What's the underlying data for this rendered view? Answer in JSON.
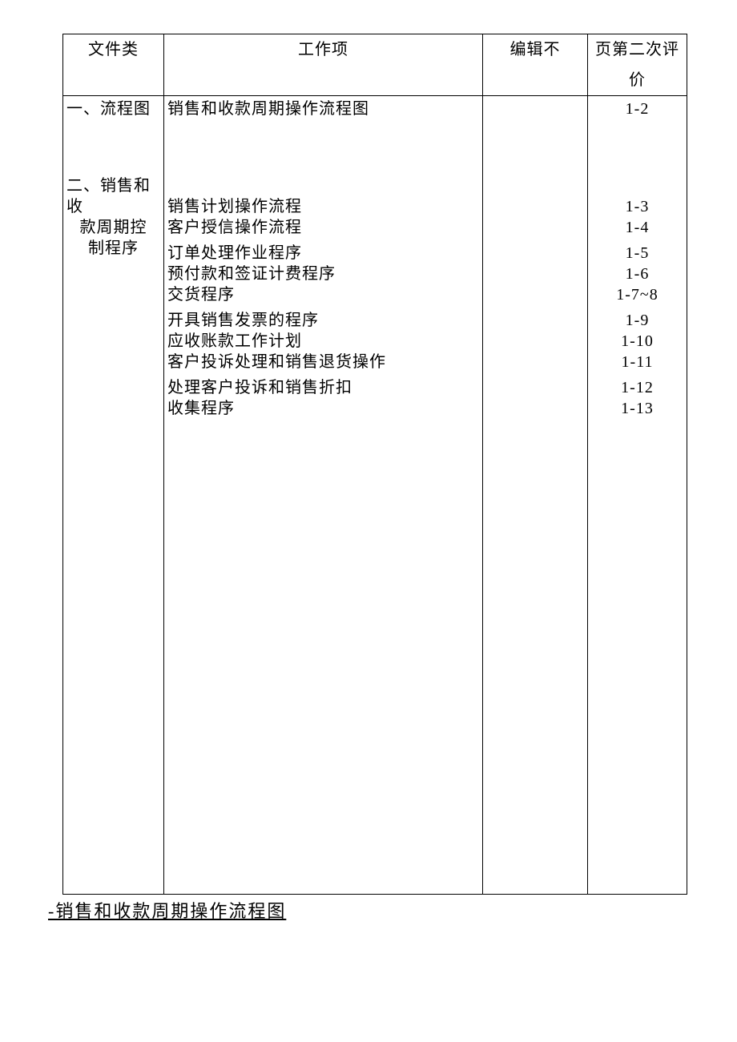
{
  "headers": {
    "col1": "文件类",
    "col2": "工作项",
    "col3": "编辑不",
    "col4": "页第二次评价"
  },
  "leftCol": {
    "sec1": "一、流程图",
    "sec2_line1": "二、销售和收",
    "sec2_line2": "款周期控",
    "sec2_line3": "制程序"
  },
  "workItems": {
    "r1": "销售和收款周期操作流程图",
    "r2": "销售计划操作流程",
    "r3": "客户授信操作流程",
    "r4": "订单处理作业程序",
    "r5": "预付款和签证计费程序",
    "r6": "交货程序",
    "r7": "开具销售发票的程序",
    "r8": "应收账款工作计划",
    "r9": "客户投诉处理和销售退货操作",
    "r10": "处理客户投诉和销售折扣",
    "r11": "收集程序"
  },
  "pages": {
    "r1": "1-2",
    "r2": "1-3",
    "r3": "1-4",
    "r4": "1-5",
    "r5": "1-6",
    "r6": "1-7~8",
    "r7": "1-9",
    "r8": "1-10",
    "r9": "1-11",
    "r10": "1-12",
    "r11": "1-13"
  },
  "footer": "-销售和收款周期操作流程图"
}
